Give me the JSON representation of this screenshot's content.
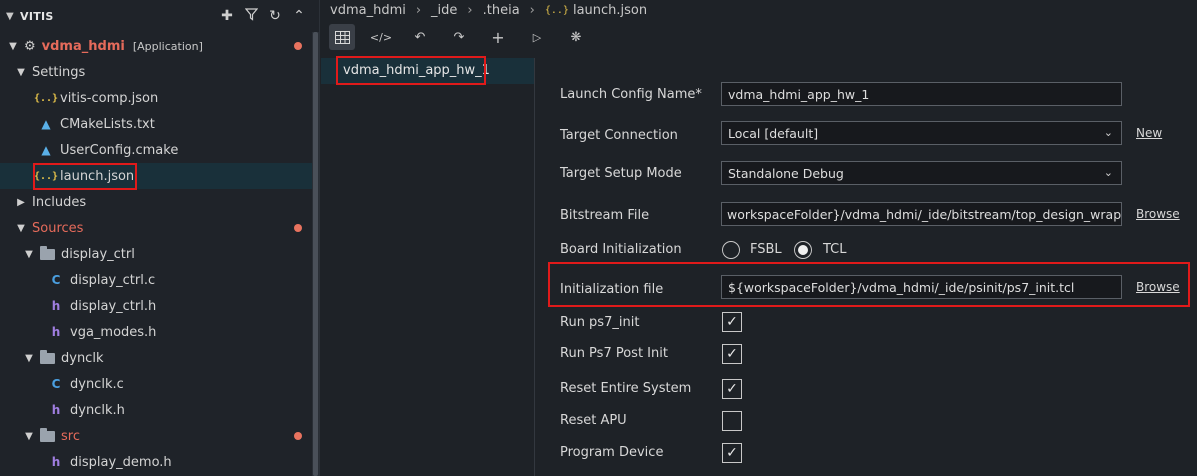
{
  "explorer": {
    "title": "VITIS",
    "project": {
      "name": "vdma_hdmi",
      "tag": "[Application]"
    },
    "items": [
      {
        "label": "Settings",
        "kind": "folder-label"
      },
      {
        "label": "vitis-comp.json",
        "icon": "json-icon"
      },
      {
        "label": "CMakeLists.txt",
        "icon": "cmake-icon"
      },
      {
        "label": "UserConfig.cmake",
        "icon": "cmake-icon"
      },
      {
        "label": "launch.json",
        "icon": "json-icon",
        "selected": true
      },
      {
        "label": "Includes",
        "kind": "folder-label"
      },
      {
        "label": "Sources",
        "kind": "folder-label"
      },
      {
        "label": "display_ctrl",
        "icon": "folder-icon"
      },
      {
        "label": "display_ctrl.c",
        "icon": "c-file-icon"
      },
      {
        "label": "display_ctrl.h",
        "icon": "h-file-icon"
      },
      {
        "label": "vga_modes.h",
        "icon": "h-file-icon"
      },
      {
        "label": "dynclk",
        "icon": "folder-icon"
      },
      {
        "label": "dynclk.c",
        "icon": "c-file-icon"
      },
      {
        "label": "dynclk.h",
        "icon": "h-file-icon"
      },
      {
        "label": "src",
        "icon": "folder-icon"
      },
      {
        "label": "display_demo.h",
        "icon": "h-file-icon"
      }
    ]
  },
  "breadcrumb": [
    "vdma_hdmi",
    "_ide",
    ".theia",
    "launch.json"
  ],
  "config_list": {
    "selected": "vdma_hdmi_app_hw_1"
  },
  "form": {
    "launch_config_name": {
      "label": "Launch Config Name*",
      "value": "vdma_hdmi_app_hw_1"
    },
    "target_connection": {
      "label": "Target Connection",
      "value": "Local [default]",
      "link": "New"
    },
    "target_setup_mode": {
      "label": "Target Setup Mode",
      "value": "Standalone Debug"
    },
    "bitstream_file": {
      "label": "Bitstream File",
      "value": "workspaceFolder}/vdma_hdmi/_ide/bitstream/top_design_wrapper.bit",
      "link": "Browse"
    },
    "board_init": {
      "label": "Board Initialization",
      "options": [
        "FSBL",
        "TCL"
      ],
      "selected": "TCL"
    },
    "init_file": {
      "label": "Initialization file",
      "value": "${workspaceFolder}/vdma_hdmi/_ide/psinit/ps7_init.tcl",
      "link": "Browse"
    },
    "checks": [
      {
        "label": "Run ps7_init",
        "checked": true
      },
      {
        "label": "Run Ps7 Post Init",
        "checked": true
      },
      {
        "label": "Reset Entire System",
        "checked": true
      },
      {
        "label": "Reset APU",
        "checked": false
      },
      {
        "label": "Program Device",
        "checked": true
      }
    ]
  },
  "colors": {
    "highlight": "#e01a1a",
    "accent_red": "#e66b5b",
    "json_icon": "#e2c04a"
  }
}
